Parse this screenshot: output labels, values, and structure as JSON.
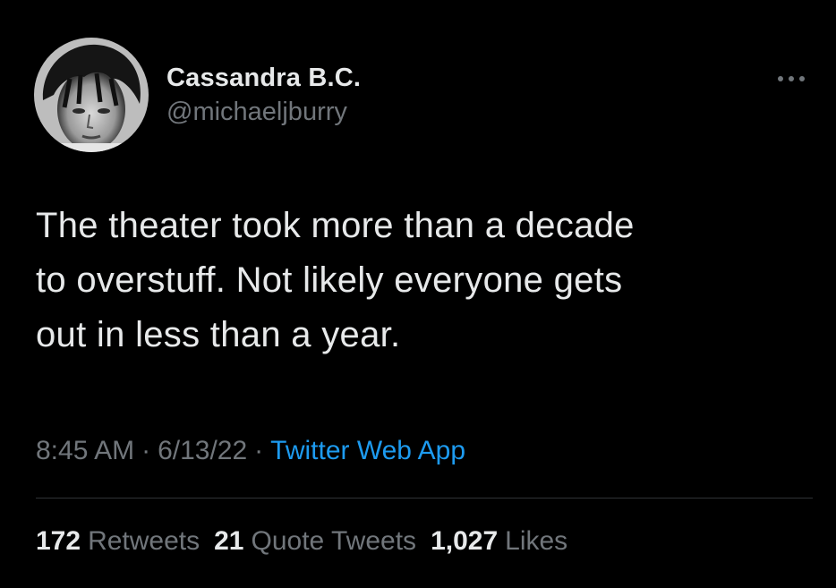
{
  "tweet": {
    "author": {
      "display_name": "Cassandra B.C.",
      "handle": "@michaeljburry",
      "avatar_icon": "profile-photo"
    },
    "more_icon": "more-horizontal-icon",
    "text": "The theater took more than a decade\nto overstuff. Not likely everyone gets\nout in less than a year.",
    "time": "8:45 AM",
    "separator": "·",
    "date": "6/13/22",
    "source": "Twitter Web App",
    "stats": {
      "retweets": {
        "count": "172",
        "label": "Retweets"
      },
      "quote_tweets": {
        "count": "21",
        "label": "Quote Tweets"
      },
      "likes": {
        "count": "1,027",
        "label": "Likes"
      }
    }
  },
  "colors": {
    "background": "#000000",
    "primary_text": "#e7e9ea",
    "secondary_text": "#71767b",
    "link": "#1d9bf0",
    "divider": "#2f3336"
  }
}
